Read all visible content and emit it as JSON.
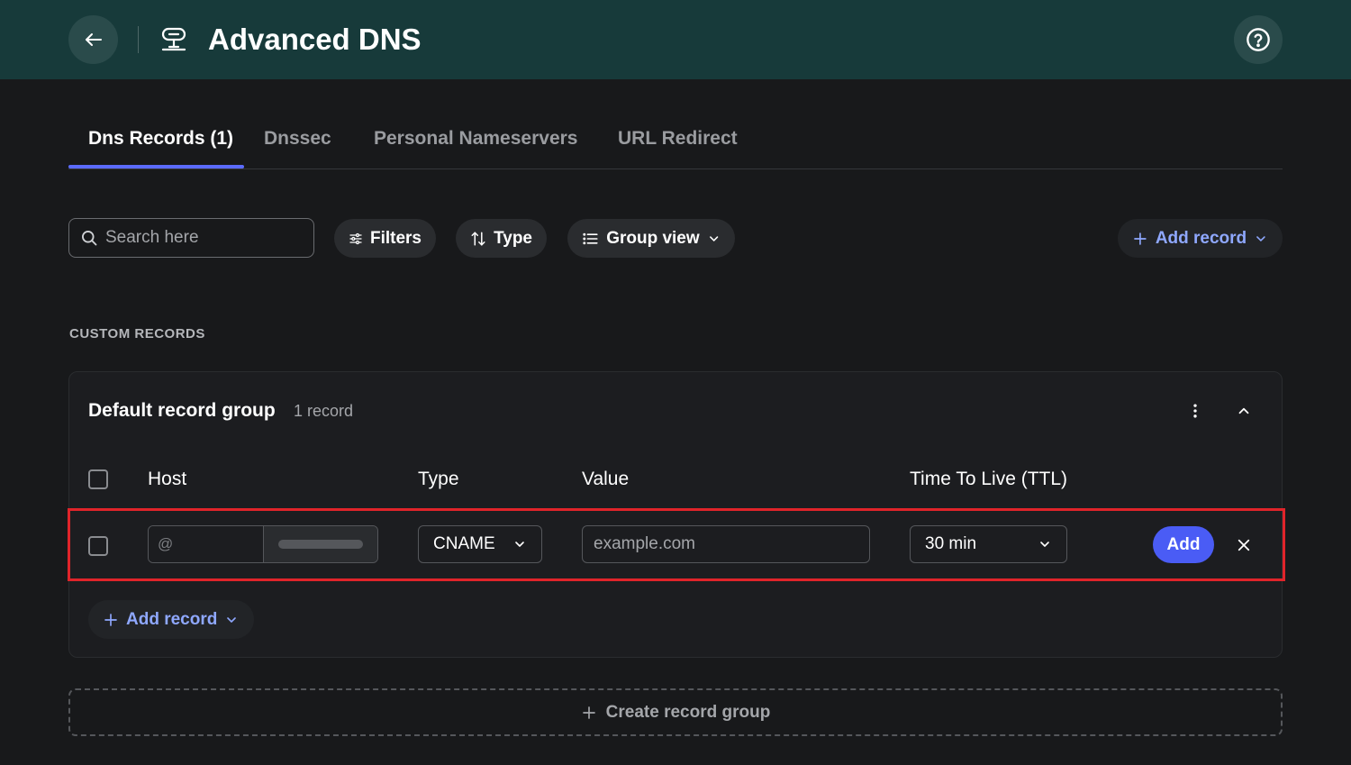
{
  "header": {
    "title": "Advanced DNS",
    "back_icon": "arrow-left-icon",
    "logo_icon": "dns-server-icon",
    "help_icon": "help-circle-icon"
  },
  "tabs": [
    {
      "label": "Dns Records (1)",
      "active": true
    },
    {
      "label": "Dnssec",
      "active": false
    },
    {
      "label": "Personal Nameservers",
      "active": false
    },
    {
      "label": "URL Redirect",
      "active": false
    }
  ],
  "toolbar": {
    "search_placeholder": "Search here",
    "filters_label": "Filters",
    "type_label": "Type",
    "group_view_label": "Group view",
    "add_record_label": "Add record"
  },
  "section": {
    "label": "CUSTOM RECORDS"
  },
  "group": {
    "title": "Default record group",
    "count": "1 record",
    "columns": [
      "Host",
      "Type",
      "Value",
      "Time To Live (TTL)"
    ],
    "new_record": {
      "host_placeholder": "@",
      "type": "CNAME",
      "value_placeholder": "example.com",
      "ttl": "30 min",
      "add_label": "Add"
    },
    "add_record_label": "Add record"
  },
  "create_group_label": "Create record group",
  "colors": {
    "header_bg": "#173a3a",
    "accent": "#5b6bff",
    "add_button": "#4a5cf5",
    "link_blue": "#8fa8ff",
    "highlight": "#e0242a"
  }
}
